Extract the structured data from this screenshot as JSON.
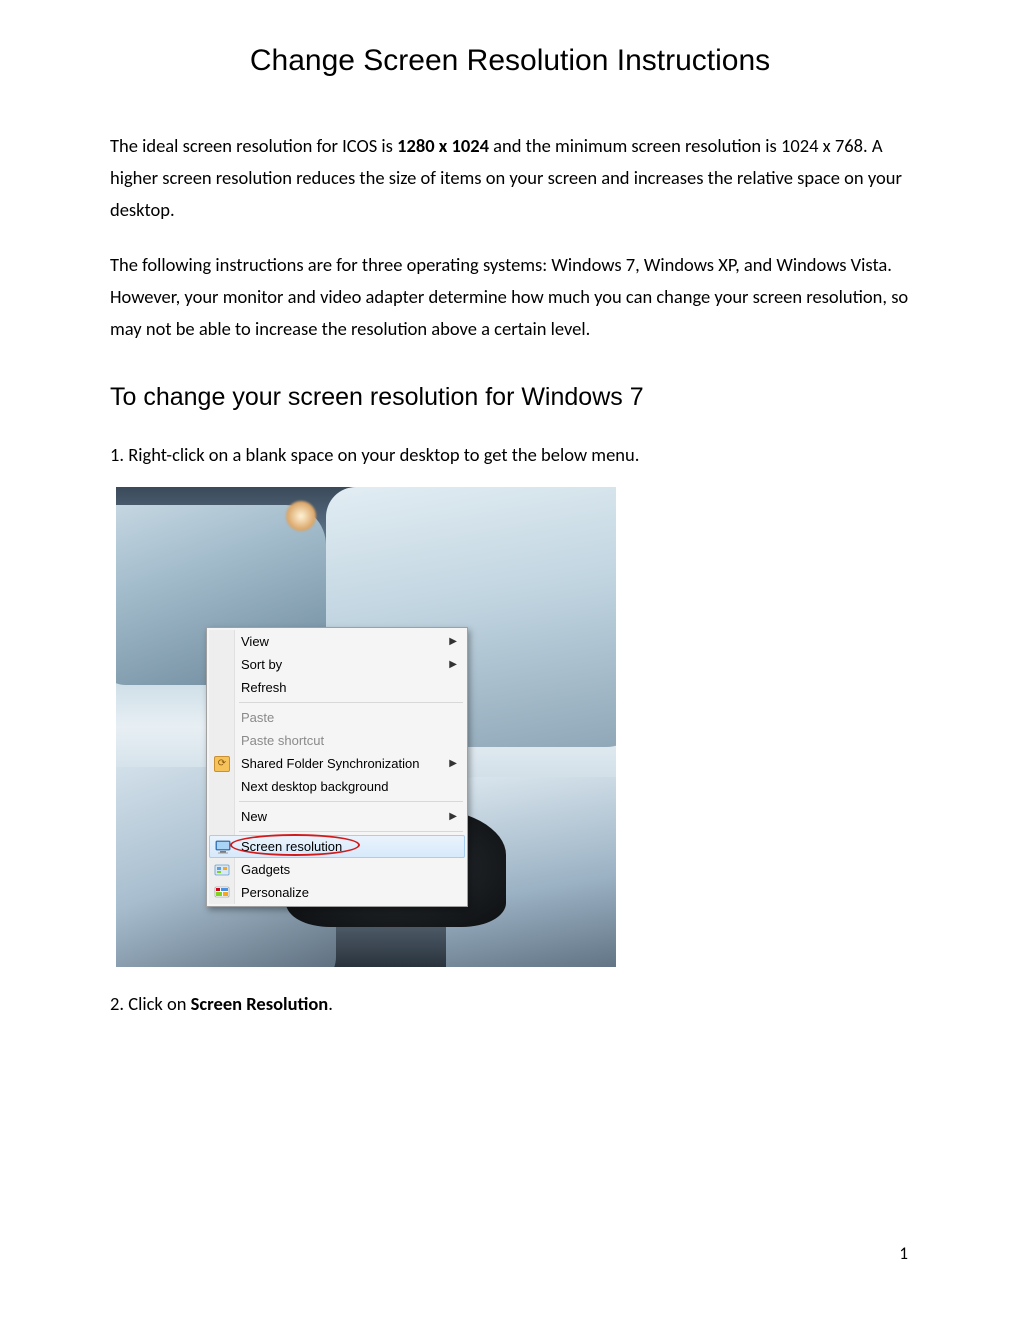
{
  "title": "Change Screen Resolution Instructions",
  "para1_a": "The ideal screen resolution for ICOS is ",
  "para1_bold": "1280 x 1024",
  "para1_b": " and the minimum screen resolution is 1024 x 768.   A higher screen resolution reduces the size of items on your screen and increases the relative space on your desktop.",
  "para2": "The following instructions are for three operating systems:  Windows 7, Windows XP, and Windows Vista.  However, your monitor and video adapter determine how much you can change your screen resolution, so may not be able to increase the resolution above a certain level.",
  "heading_win7": "To change your screen resolution for Windows 7",
  "step1": "1.  Right-click on a blank space on your desktop to get the below menu.",
  "step2_a": "2.  Click on ",
  "step2_bold": "Screen Resolution",
  "step2_b": ".",
  "page_number": "1",
  "context_menu": {
    "items": {
      "view": "View",
      "sort_by": "Sort by",
      "refresh": "Refresh",
      "paste": "Paste",
      "paste_shortcut": "Paste shortcut",
      "shared_sync": "Shared Folder Synchronization",
      "next_bg": "Next desktop background",
      "new": "New",
      "screen_res": "Screen resolution",
      "gadgets": "Gadgets",
      "personalize": "Personalize"
    }
  }
}
